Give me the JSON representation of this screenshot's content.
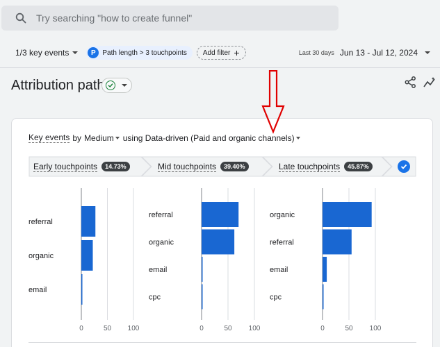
{
  "search": {
    "placeholder": "Try searching \"how to create funnel\""
  },
  "filters": {
    "key_events": "1/3 key events",
    "chip_letter": "P",
    "chip_label": "Path length > 3 touchpoints",
    "add_filter": "Add filter"
  },
  "date": {
    "label": "Last 30 days",
    "range": "Jun 13 - Jul 12, 2024"
  },
  "page": {
    "title": "Attribution paths"
  },
  "card": {
    "key_events": "Key events",
    "by": "by",
    "dimension": "Medium",
    "using": "using Data-driven (Paid and organic channels)"
  },
  "touchpoints": [
    {
      "label": "Early touchpoints",
      "pct": "14.73%"
    },
    {
      "label": "Mid touchpoints",
      "pct": "39.40%"
    },
    {
      "label": "Late touchpoints",
      "pct": "45.87%"
    }
  ],
  "colors": {
    "accent": "#1a73e8",
    "bar": "#1967d2",
    "arrow": "#e00000"
  },
  "chart_data": [
    {
      "type": "bar",
      "orientation": "horizontal",
      "categories": [
        "referral",
        "organic",
        "email"
      ],
      "values": [
        27,
        22,
        1
      ],
      "xlim": [
        0,
        100
      ],
      "xticks": [
        "0",
        "50",
        "100"
      ]
    },
    {
      "type": "bar",
      "orientation": "horizontal",
      "categories": [
        "referral",
        "organic",
        "email",
        "cpc"
      ],
      "values": [
        70,
        62,
        1,
        1
      ],
      "xlim": [
        0,
        100
      ],
      "xticks": [
        "0",
        "50",
        "100"
      ]
    },
    {
      "type": "bar",
      "orientation": "horizontal",
      "categories": [
        "organic",
        "referral",
        "email",
        "cpc"
      ],
      "values": [
        93,
        55,
        8,
        1
      ],
      "xlim": [
        0,
        100
      ],
      "xticks": [
        "0",
        "50",
        "100"
      ]
    }
  ]
}
